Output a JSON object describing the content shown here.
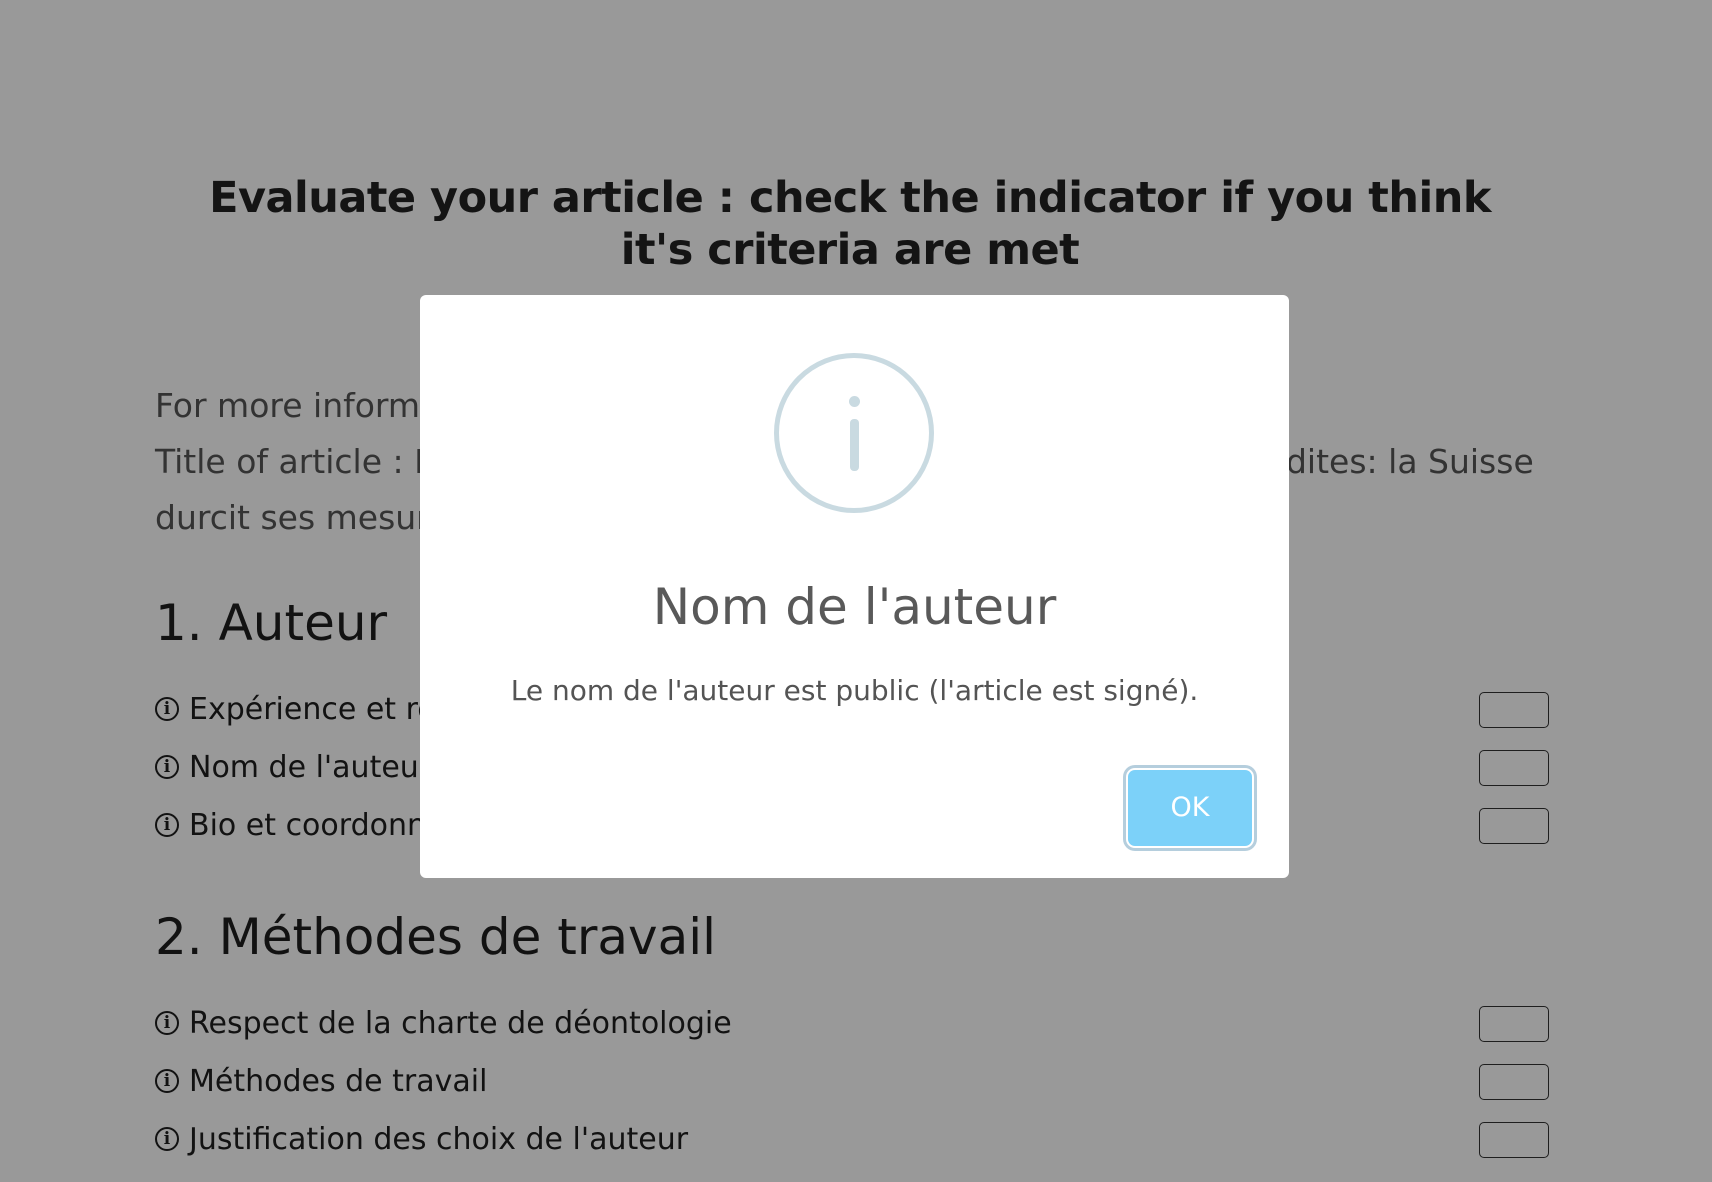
{
  "page": {
    "heading": "Evaluate your article : check the indicator if you think it's criteria are met",
    "info": {
      "more_info": "For more information",
      "title_prefix": "Title of article : E",
      "title_suffix": "rdites: la Suisse",
      "title_line2": "durcit ses mesur"
    },
    "sections": [
      {
        "title": "1. Auteur",
        "items": [
          {
            "label": "Expérience et ré",
            "checked": false
          },
          {
            "label": "Nom de l'auteur",
            "checked": false
          },
          {
            "label": "Bio et coordonn",
            "checked": false
          }
        ]
      },
      {
        "title": "2. Méthodes de travail",
        "items": [
          {
            "label": "Respect de la charte de déontologie",
            "checked": false
          },
          {
            "label": "Méthodes de travail",
            "checked": false
          },
          {
            "label": "Justification des choix de l'auteur",
            "checked": false
          }
        ]
      }
    ],
    "info_icon": "info-circle-icon"
  },
  "modal": {
    "icon": "info-icon",
    "title": "Nom de l'auteur",
    "text": "Le nom de l'auteur est public (l'article est signé).",
    "ok_label": "OK",
    "ok_color": "#7cd1f9"
  }
}
